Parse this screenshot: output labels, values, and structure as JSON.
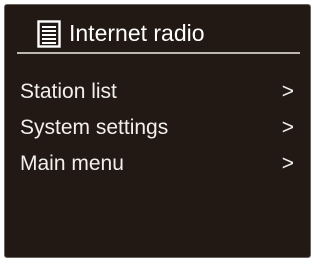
{
  "header": {
    "icon": "list-document-icon",
    "title": "Internet radio"
  },
  "menu": {
    "items": [
      {
        "label": "Station list",
        "arrow": ">"
      },
      {
        "label": "System settings",
        "arrow": ">"
      },
      {
        "label": "Main menu",
        "arrow": ">"
      }
    ]
  },
  "colors": {
    "background": "#221914",
    "text": "#f2efec",
    "divider": "#bdb6b1"
  }
}
